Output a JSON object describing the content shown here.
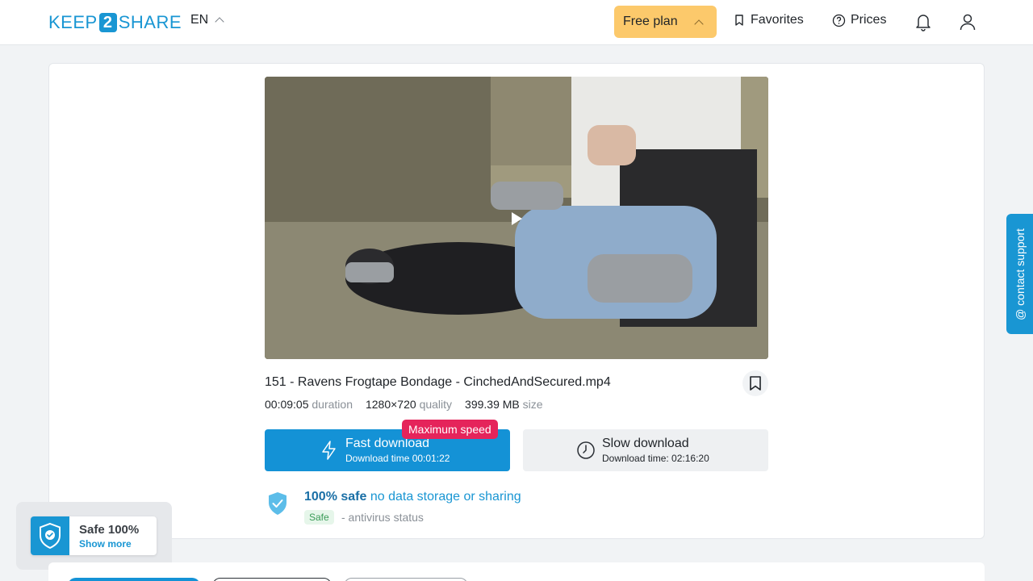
{
  "header": {
    "logo_left": "KEEP",
    "logo_num": "2",
    "logo_right": "SHARE",
    "lang": "EN",
    "plan_label": "Free plan",
    "favorites_label": "Favorites",
    "prices_label": "Prices"
  },
  "file": {
    "title": "151 - Ravens Frogtape Bondage - CinchedAndSecured.mp4",
    "duration": "00:09:05",
    "duration_label": "duration",
    "quality": "1280×720",
    "quality_label": "quality",
    "size": "399.39 MB",
    "size_label": "size"
  },
  "downloads": {
    "max_badge": "Maximum speed",
    "fast_label": "Fast download",
    "fast_time": "Download time 00:01:22",
    "slow_label": "Slow download",
    "slow_time": "Download time: 02:16:20"
  },
  "safety": {
    "bold": "100% safe",
    "rest": " no data storage or sharing",
    "pill": "Safe",
    "status": "- antivirus status"
  },
  "support": {
    "label": "@ contact support"
  },
  "safe_widget": {
    "title": "Safe 100%",
    "link": "Show more"
  },
  "colors": {
    "accent": "#1996d3",
    "plan": "#fcc96b",
    "badge": "#e5245b"
  }
}
